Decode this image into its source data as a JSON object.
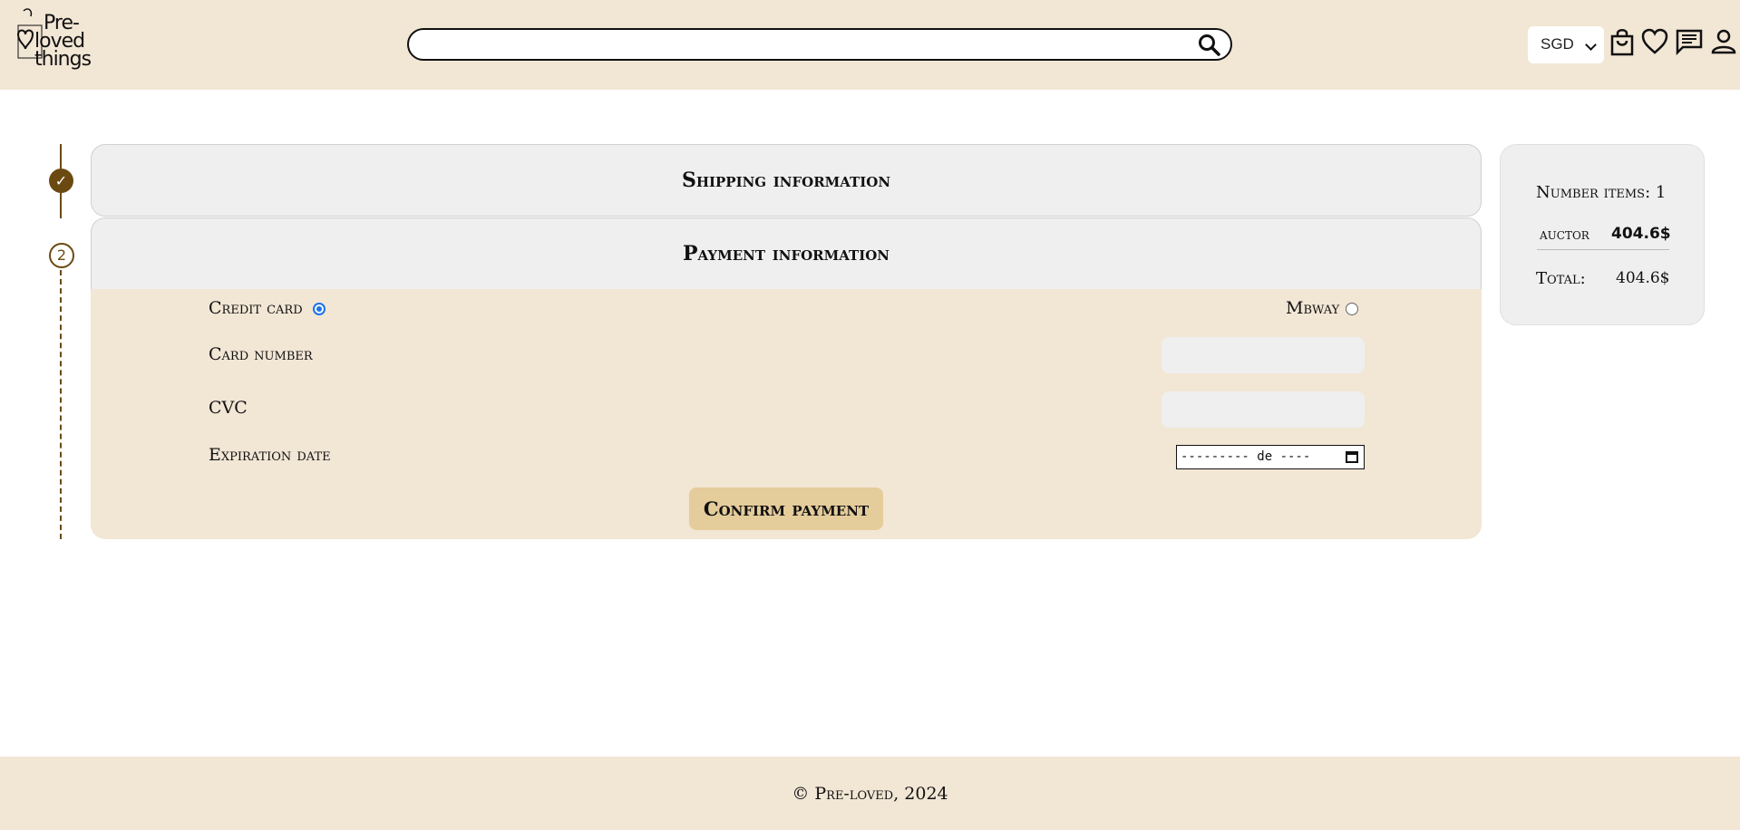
{
  "header": {
    "logo_line1": "Pre-",
    "logo_line2": "loved",
    "logo_line3": "things",
    "search_placeholder": "",
    "currency": "SGD",
    "icons": [
      "shopping-bag-icon",
      "heart-icon",
      "chat-icon",
      "user-icon"
    ]
  },
  "stepper": {
    "step1": "✓",
    "step2": "2"
  },
  "shipping": {
    "title": "Shipping information"
  },
  "payment": {
    "title": "Payment information",
    "credit_card_label": "Credit card",
    "mbway_label": "Mbway",
    "card_number_label": "Card number",
    "cvc_label": "CVC",
    "expiration_label": "Expiration date",
    "date_value": "--------- de ----",
    "confirm_label": "Confirm payment",
    "selected_method": "credit_card"
  },
  "summary": {
    "items_label": "Number items: 1",
    "seller": "auctor",
    "seller_price": "404.6$",
    "total_label": "Total:",
    "total_value": "404.6$"
  },
  "footer": {
    "text": "© Pre-loved, 2024"
  },
  "colors": {
    "header_bg": "#f2e6d5",
    "accent_brown": "#6b4a12",
    "button_bg": "#e5cc9b",
    "panel_gray": "#efefef"
  }
}
